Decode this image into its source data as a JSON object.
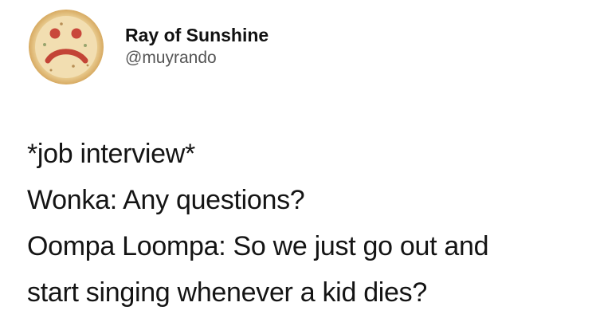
{
  "tweet": {
    "author": {
      "display_name": "Ray of Sunshine",
      "handle": "@muyrando",
      "avatar_icon": "frowning-pizza-avatar-icon"
    },
    "lines": [
      "*job interview*",
      "Wonka: Any questions?",
      "Oompa Loompa: So we just go out and",
      "start singing whenever a kid dies?"
    ]
  }
}
